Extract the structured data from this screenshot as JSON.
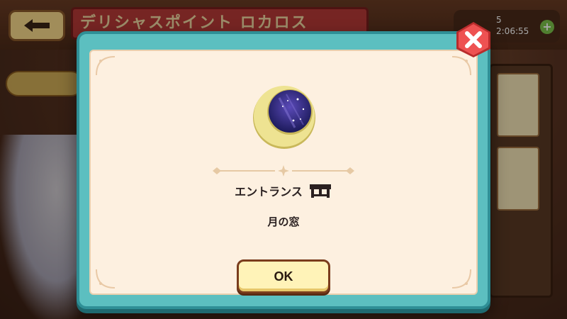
{
  "background": {
    "title_banner": "デリシャスポイント ロカロス",
    "counter_value": "5",
    "counter_timer": "2:06:55",
    "counter_plus": "+"
  },
  "dialog": {
    "item_icon": "crescent-moon-window-icon",
    "category_label": "エントランス",
    "category_icon": "furniture-table-icon",
    "item_name": "月の窓",
    "ok_label": "OK",
    "close_icon": "close-x-icon"
  },
  "colors": {
    "dialog_border": "#5cbfc0",
    "dialog_fill": "#fdf0e0",
    "close_button": "#e84a4a",
    "ok_button": "#fff3b8",
    "moon_gold": "#eadf8a",
    "night_sky": "#2a2a7a"
  }
}
